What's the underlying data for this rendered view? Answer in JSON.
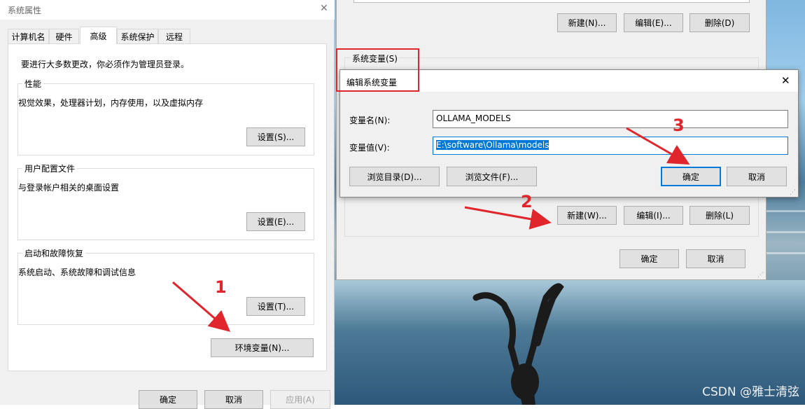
{
  "system_properties": {
    "title": "系统属性",
    "close_glyph": "✕",
    "tabs": [
      "计算机名",
      "硬件",
      "高级",
      "系统保护",
      "远程"
    ],
    "active_tab": "高级",
    "admin_note": "要进行大多数更改，你必须作为管理员登录。",
    "performance": {
      "title": "性能",
      "desc": "视觉效果，处理器计划，内存使用，以及虚拟内存",
      "button": "设置(S)..."
    },
    "user_profiles": {
      "title": "用户配置文件",
      "desc": "与登录帐户相关的桌面设置",
      "button": "设置(E)..."
    },
    "startup_recovery": {
      "title": "启动和故障恢复",
      "desc": "系统启动、系统故障和调试信息",
      "button": "设置(T)..."
    },
    "env_button": "环境变量(N)...",
    "footer": {
      "ok": "确定",
      "cancel": "取消",
      "apply": "应用(A)"
    }
  },
  "env_vars": {
    "user_buttons": {
      "new": "新建(N)...",
      "edit": "编辑(E)...",
      "delete": "删除(D)"
    },
    "system_section": "系统变量(S)",
    "system_buttons": {
      "new": "新建(W)...",
      "edit": "编辑(I)...",
      "delete": "删除(L)"
    },
    "footer": {
      "ok": "确定",
      "cancel": "取消"
    }
  },
  "edit_dialog": {
    "title": "编辑系统变量",
    "close_glyph": "✕",
    "name_label": "变量名(N):",
    "name_value": "OLLAMA_MODELS",
    "value_label": "变量值(V):",
    "value_value": "E:\\software\\Ollama\\models",
    "browse_dir": "浏览目录(D)...",
    "browse_file": "浏览文件(F)...",
    "ok": "确定",
    "cancel": "取消"
  },
  "annotations": {
    "step1": "1",
    "step2": "2",
    "step3": "3"
  },
  "watermark": "CSDN @雅士清弦",
  "colors": {
    "accent": "#0078d7",
    "annotation": "#e0262c"
  }
}
